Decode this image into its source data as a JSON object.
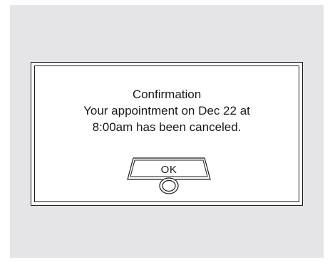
{
  "dialog": {
    "title": "Confirmation",
    "message_line1": "Your appointment on Dec 22 at",
    "message_line2": "8:00am has been canceled.",
    "ok_label": "OK"
  },
  "colors": {
    "background": "#e5e5e7",
    "dialog": "#ffffff",
    "border": "#1a1a1a"
  }
}
